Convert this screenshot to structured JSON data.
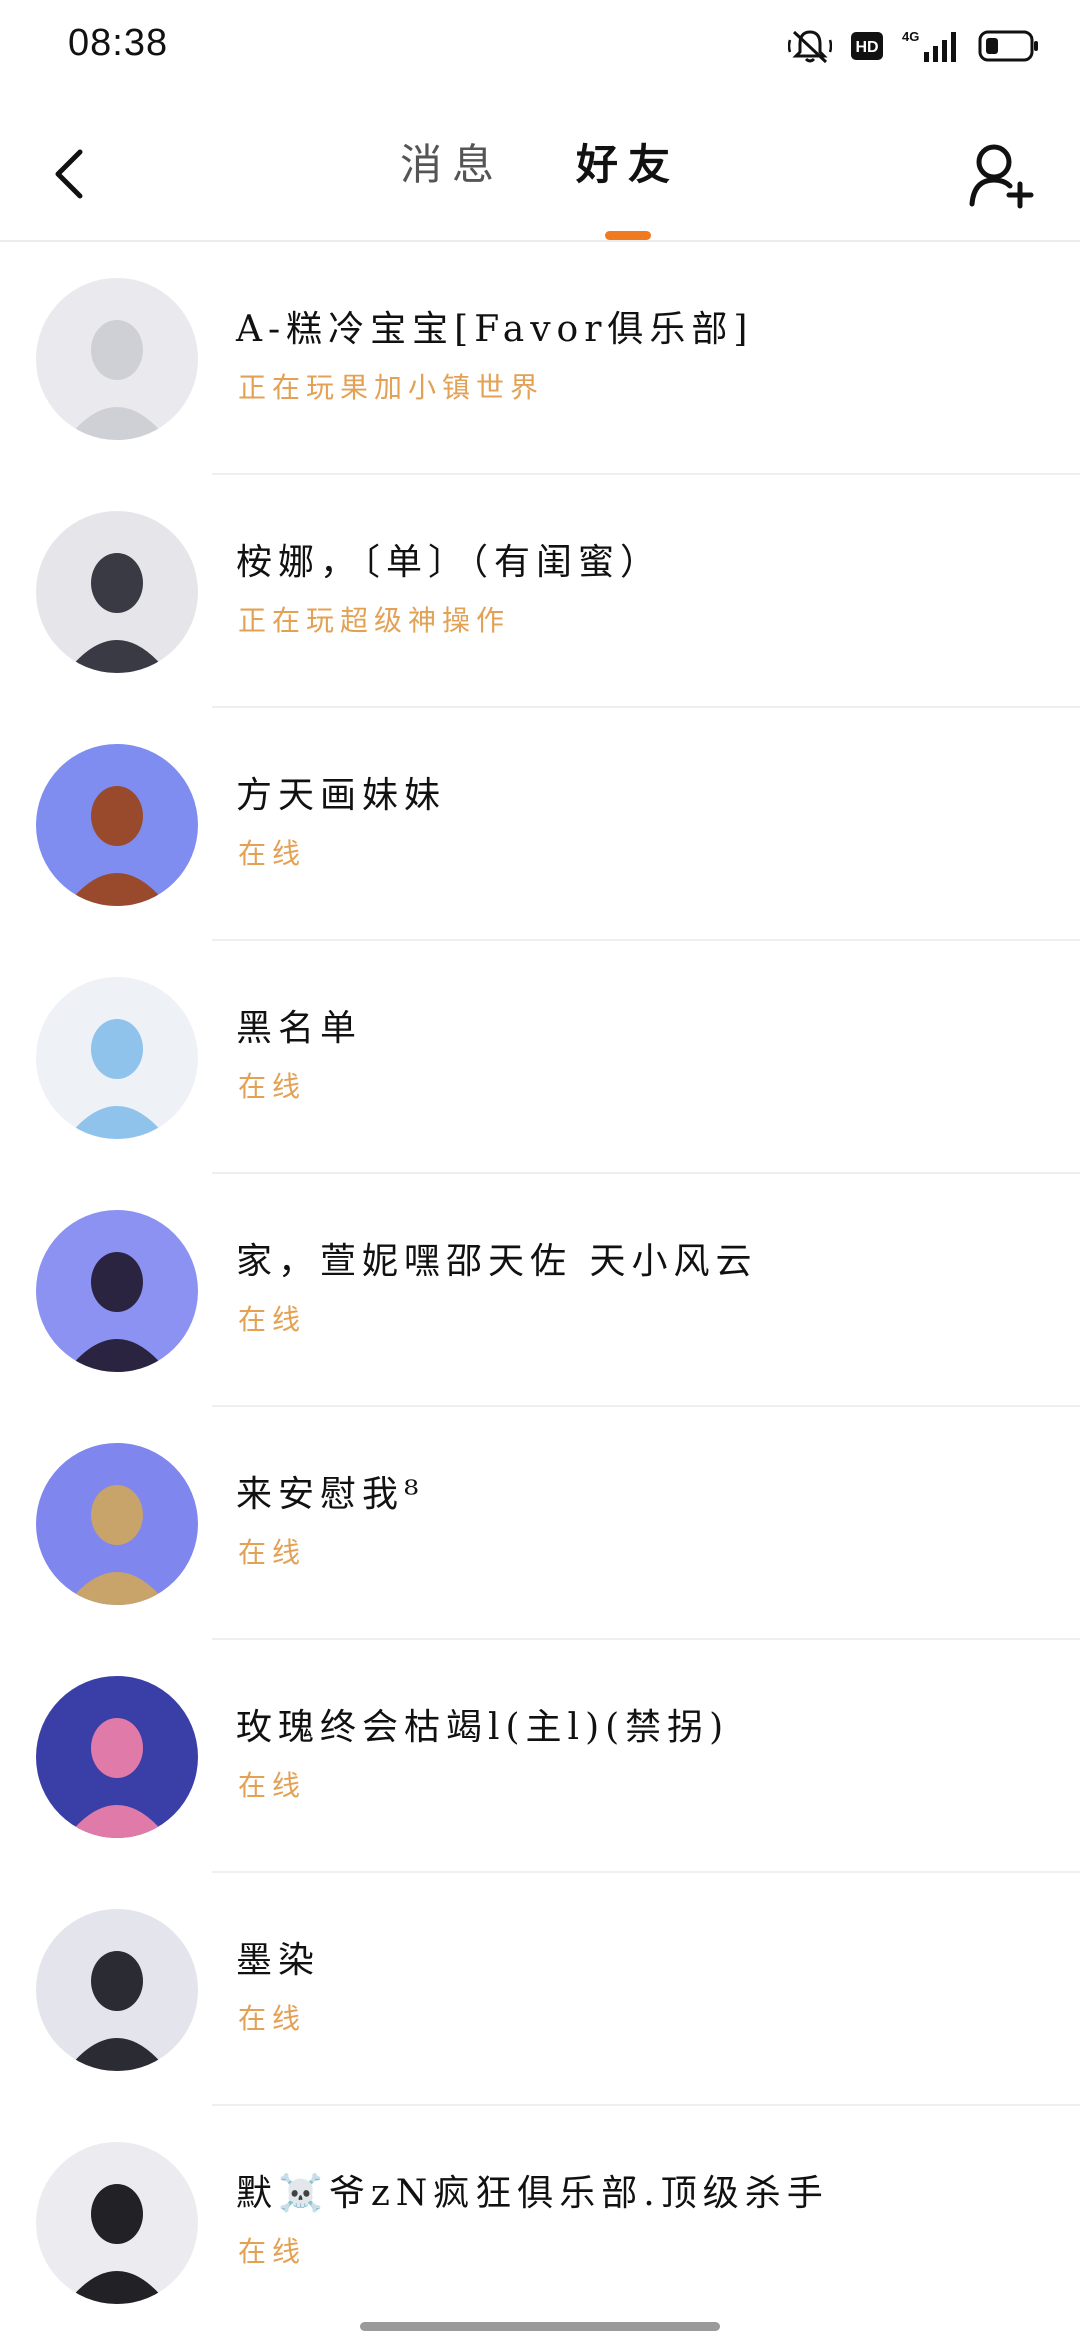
{
  "status_bar": {
    "time": "08:38",
    "hd_badge": "HD",
    "network": "4G",
    "icons": [
      "mute-bell-icon",
      "hd-icon",
      "signal-icon",
      "battery-icon"
    ]
  },
  "header": {
    "tabs": [
      {
        "label": "消息",
        "active": false
      },
      {
        "label": "好友",
        "active": true
      }
    ],
    "accent_color": "#f07a20",
    "icons": [
      "back-arrow-icon",
      "add-friend-icon"
    ]
  },
  "friends": [
    {
      "name": "A-糕冷宝宝[Favor俱乐部]",
      "status": "正在玩果加小镇世界",
      "avatar_bg": "#e9e9ee",
      "avatar_fg": "#cfcfd6"
    },
    {
      "name": "桉娜，〔单〕（有闺蜜）",
      "status": "正在玩超级神操作",
      "avatar_bg": "#e6e6ea",
      "avatar_fg": "#3a3a44"
    },
    {
      "name": "方天画妹妹",
      "status": "在线",
      "avatar_bg": "#7f8df0",
      "avatar_fg": "#9a4a2c"
    },
    {
      "name": "黑名单",
      "status": "在线",
      "avatar_bg": "#eef1f6",
      "avatar_fg": "#8fc3ec"
    },
    {
      "name": "家，萱妮嘿邵天佐 天小风云",
      "status": "在线",
      "avatar_bg": "#8c92f2",
      "avatar_fg": "#2a2440"
    },
    {
      "name": "来安慰我⁸",
      "status": "在线",
      "avatar_bg": "#7f86ee",
      "avatar_fg": "#c8a36a"
    },
    {
      "name": "玫瑰终会枯竭l(主l)(禁拐)",
      "status": "在线",
      "avatar_bg": "#3a3fa8",
      "avatar_fg": "#e07aa8"
    },
    {
      "name": "墨染",
      "status": "在线",
      "avatar_bg": "#e4e4ec",
      "avatar_fg": "#2b2b33"
    },
    {
      "name": "默☠️爷zN疯狂俱乐部.顶级杀手",
      "status": "在线",
      "avatar_bg": "#ececf0",
      "avatar_fg": "#222226"
    }
  ],
  "colors": {
    "status_text": "#e3a155",
    "divider": "#efefef"
  }
}
